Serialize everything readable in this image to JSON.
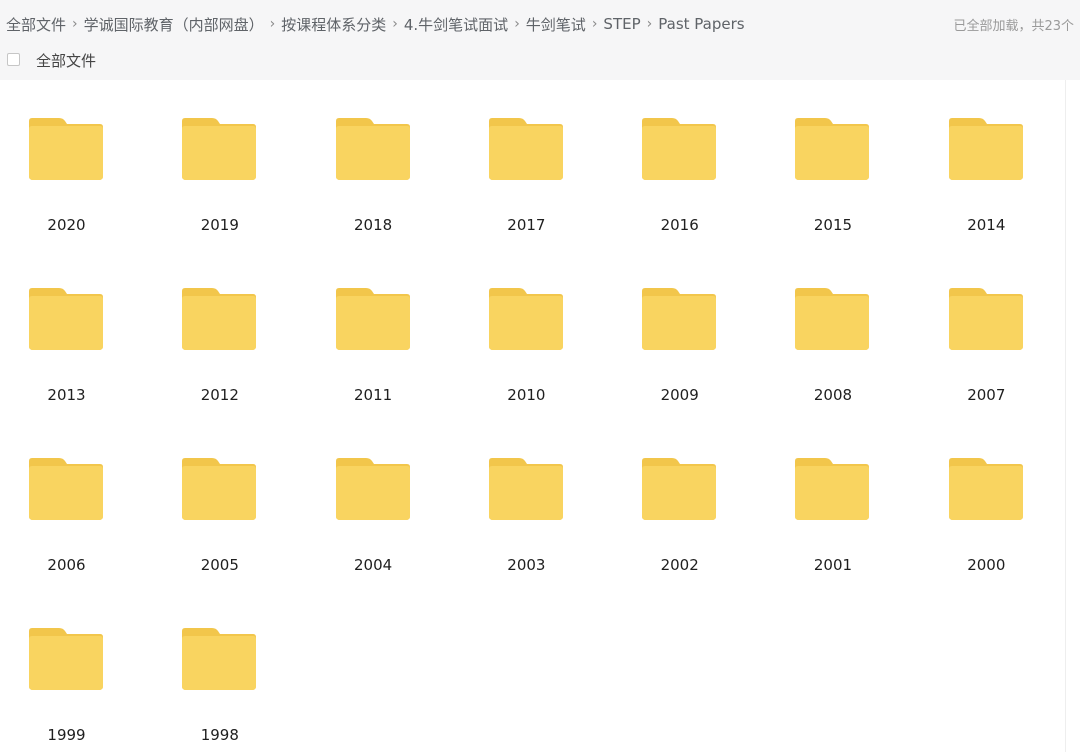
{
  "breadcrumb": [
    "全部文件",
    "学诚国际教育（内部网盘）",
    "按课程体系分类",
    "4.牛剑笔试面试",
    "牛剑笔试",
    "STEP",
    "Past Papers"
  ],
  "load_info": "已全部加载，共23个",
  "select_all": {
    "label": "全部文件",
    "checked": false
  },
  "folder_color": "#f9d460",
  "folder_tab_color": "#f2c64b",
  "folders": [
    "2020",
    "2019",
    "2018",
    "2017",
    "2016",
    "2015",
    "2014",
    "2013",
    "2012",
    "2011",
    "2010",
    "2009",
    "2008",
    "2007",
    "2006",
    "2005",
    "2004",
    "2003",
    "2002",
    "2001",
    "2000",
    "1999",
    "1998"
  ]
}
